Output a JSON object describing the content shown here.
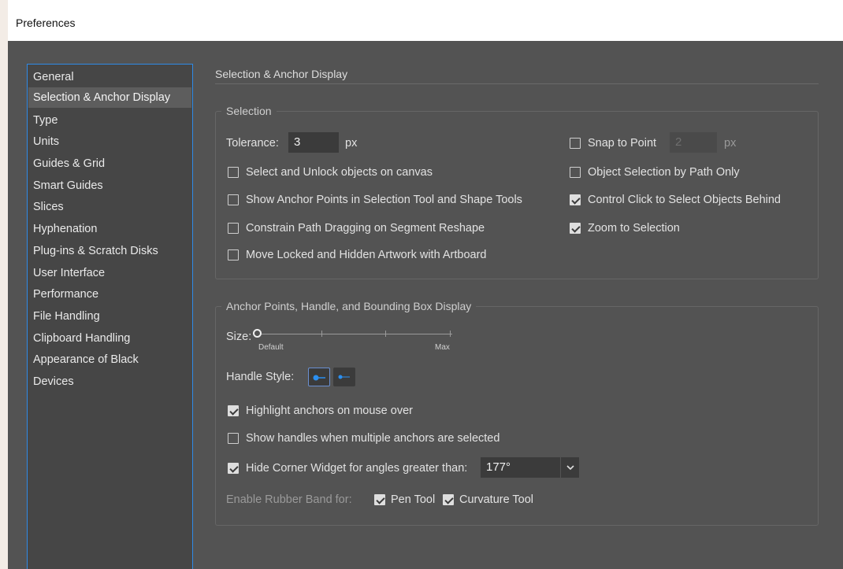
{
  "window": {
    "title": "Preferences"
  },
  "sidebar": {
    "items": [
      {
        "label": "General"
      },
      {
        "label": "Selection & Anchor Display",
        "selected": true
      },
      {
        "label": "Type"
      },
      {
        "label": "Units"
      },
      {
        "label": "Guides & Grid"
      },
      {
        "label": "Smart Guides"
      },
      {
        "label": "Slices"
      },
      {
        "label": "Hyphenation"
      },
      {
        "label": "Plug-ins & Scratch Disks"
      },
      {
        "label": "User Interface"
      },
      {
        "label": "Performance"
      },
      {
        "label": "File Handling"
      },
      {
        "label": "Clipboard Handling"
      },
      {
        "label": "Appearance of Black"
      },
      {
        "label": "Devices"
      }
    ]
  },
  "main": {
    "heading": "Selection & Anchor Display",
    "selection": {
      "group_label": "Selection",
      "tolerance_label": "Tolerance:",
      "tolerance_value": "3",
      "tolerance_unit": "px",
      "snap_to_point_label": "Snap to Point",
      "snap_to_point_checked": false,
      "snap_value": "2",
      "snap_unit": "px",
      "select_unlock_label": "Select and Unlock objects on canvas",
      "select_unlock_checked": false,
      "show_anchor_points_label": "Show Anchor Points in Selection Tool and Shape Tools",
      "show_anchor_points_checked": false,
      "constrain_path_label": "Constrain Path Dragging on Segment Reshape",
      "constrain_path_checked": false,
      "move_locked_label": "Move Locked and Hidden Artwork with Artboard",
      "move_locked_checked": false,
      "object_selection_label": "Object Selection by Path Only",
      "object_selection_checked": false,
      "control_click_label": "Control Click to Select Objects Behind",
      "control_click_checked": true,
      "zoom_to_selection_label": "Zoom to Selection",
      "zoom_to_selection_checked": true
    },
    "anchor_display": {
      "group_label": "Anchor Points, Handle, and Bounding Box Display",
      "size_label": "Size:",
      "size_min_label": "Default",
      "size_max_label": "Max",
      "size_level": 0,
      "handle_style_label": "Handle Style:",
      "handle_style_selected": 0,
      "highlight_anchors_label": "Highlight anchors on mouse over",
      "highlight_anchors_checked": true,
      "show_handles_label": "Show handles when multiple anchors are selected",
      "show_handles_checked": false,
      "hide_corner_label": "Hide Corner Widget for angles greater than:",
      "hide_corner_checked": true,
      "hide_corner_value": "177°",
      "rubber_band_label": "Enable Rubber Band for:",
      "pen_tool_label": "Pen Tool",
      "pen_tool_checked": true,
      "curvature_tool_label": "Curvature Tool",
      "curvature_tool_checked": true
    }
  },
  "colors": {
    "dialog_bg": "#535353",
    "list_bg": "#464646",
    "focus_border": "#2f8ae6",
    "handle_accent": "#2b8ff0"
  }
}
